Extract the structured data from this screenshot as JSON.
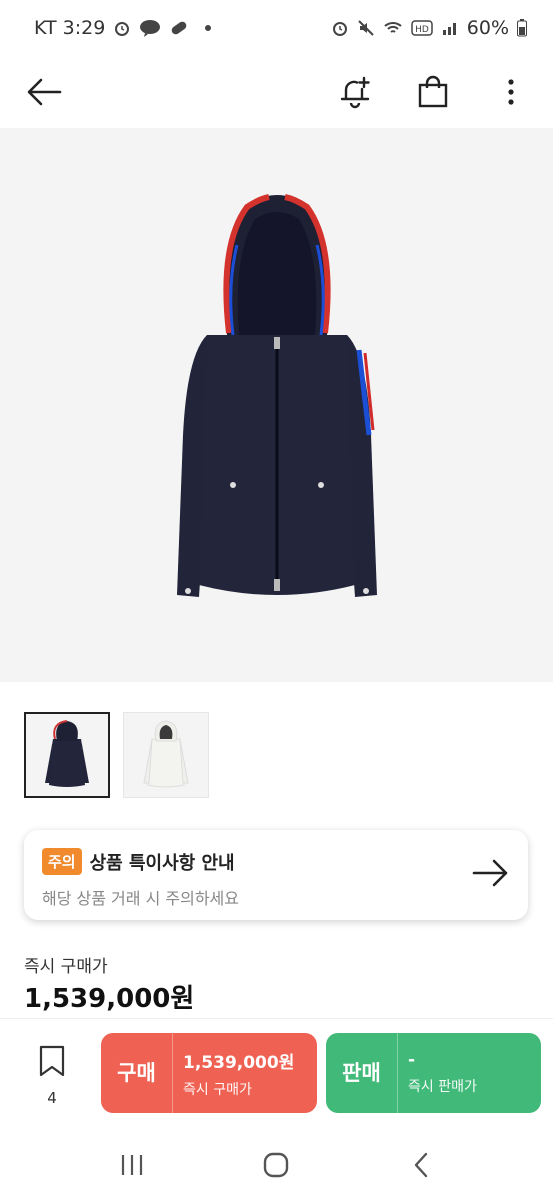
{
  "status_bar": {
    "carrier_time": "KT 3:29",
    "battery": "60%",
    "icons_left": [
      "alarm-icon",
      "kakaotalk-icon",
      "pill-icon"
    ],
    "icons_right": [
      "alarm-icon",
      "mute-icon",
      "wifi-icon",
      "hd-icon",
      "signal-icon",
      "battery-icon"
    ]
  },
  "app_bar": {
    "icons": [
      "back-arrow-icon",
      "bell-add-icon",
      "shopping-bag-icon",
      "more-vert-icon"
    ]
  },
  "product": {
    "image": "navy-hooded-jacket-icon",
    "thumbnails": [
      "navy-jacket-thumbnail",
      "white-jacket-thumbnail"
    ]
  },
  "notice": {
    "badge": "주의",
    "title": "상품 특이사항 안내",
    "subtitle": "해당 상품 거래 시 주의하세요"
  },
  "price": {
    "label": "즉시 구매가",
    "value": "1,539,000원"
  },
  "action_bar": {
    "wish_count": "4",
    "buy": {
      "label": "구매",
      "price": "1,539,000원",
      "caption": "즉시 구매가",
      "color": "#ef6253"
    },
    "sell": {
      "label": "판매",
      "price": "-",
      "caption": "즉시 판매가",
      "color": "#41b979"
    }
  },
  "nav_bar": {
    "icons": [
      "recent-apps-icon",
      "home-icon",
      "back-icon"
    ]
  }
}
